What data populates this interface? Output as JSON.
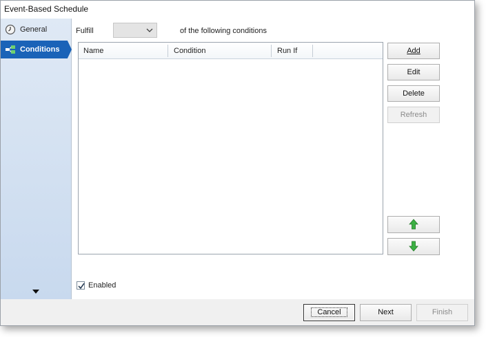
{
  "window": {
    "title": "Event-Based Schedule"
  },
  "sidebar": {
    "items": [
      {
        "label": "General",
        "icon": "clock-icon",
        "active": false
      },
      {
        "label": "Conditions",
        "icon": "conditions-icon",
        "active": true
      }
    ]
  },
  "conditions": {
    "fulfill_label": "Fulfill",
    "fulfill_value": "",
    "suffix": "of the following conditions",
    "columns": [
      "Name",
      "Condition",
      "Run If"
    ],
    "rows": [],
    "buttons": {
      "add": "Add",
      "edit": "Edit",
      "delete": "Delete",
      "refresh": "Refresh"
    },
    "move_up_icon": "arrow-up-icon",
    "move_down_icon": "arrow-down-icon",
    "enabled_label": "Enabled",
    "enabled_checked": true
  },
  "footer": {
    "cancel": "Cancel",
    "next": "Next",
    "finish": "Finish"
  },
  "colors": {
    "accent": "#1a63b8",
    "arrow_green": "#3cb043"
  }
}
